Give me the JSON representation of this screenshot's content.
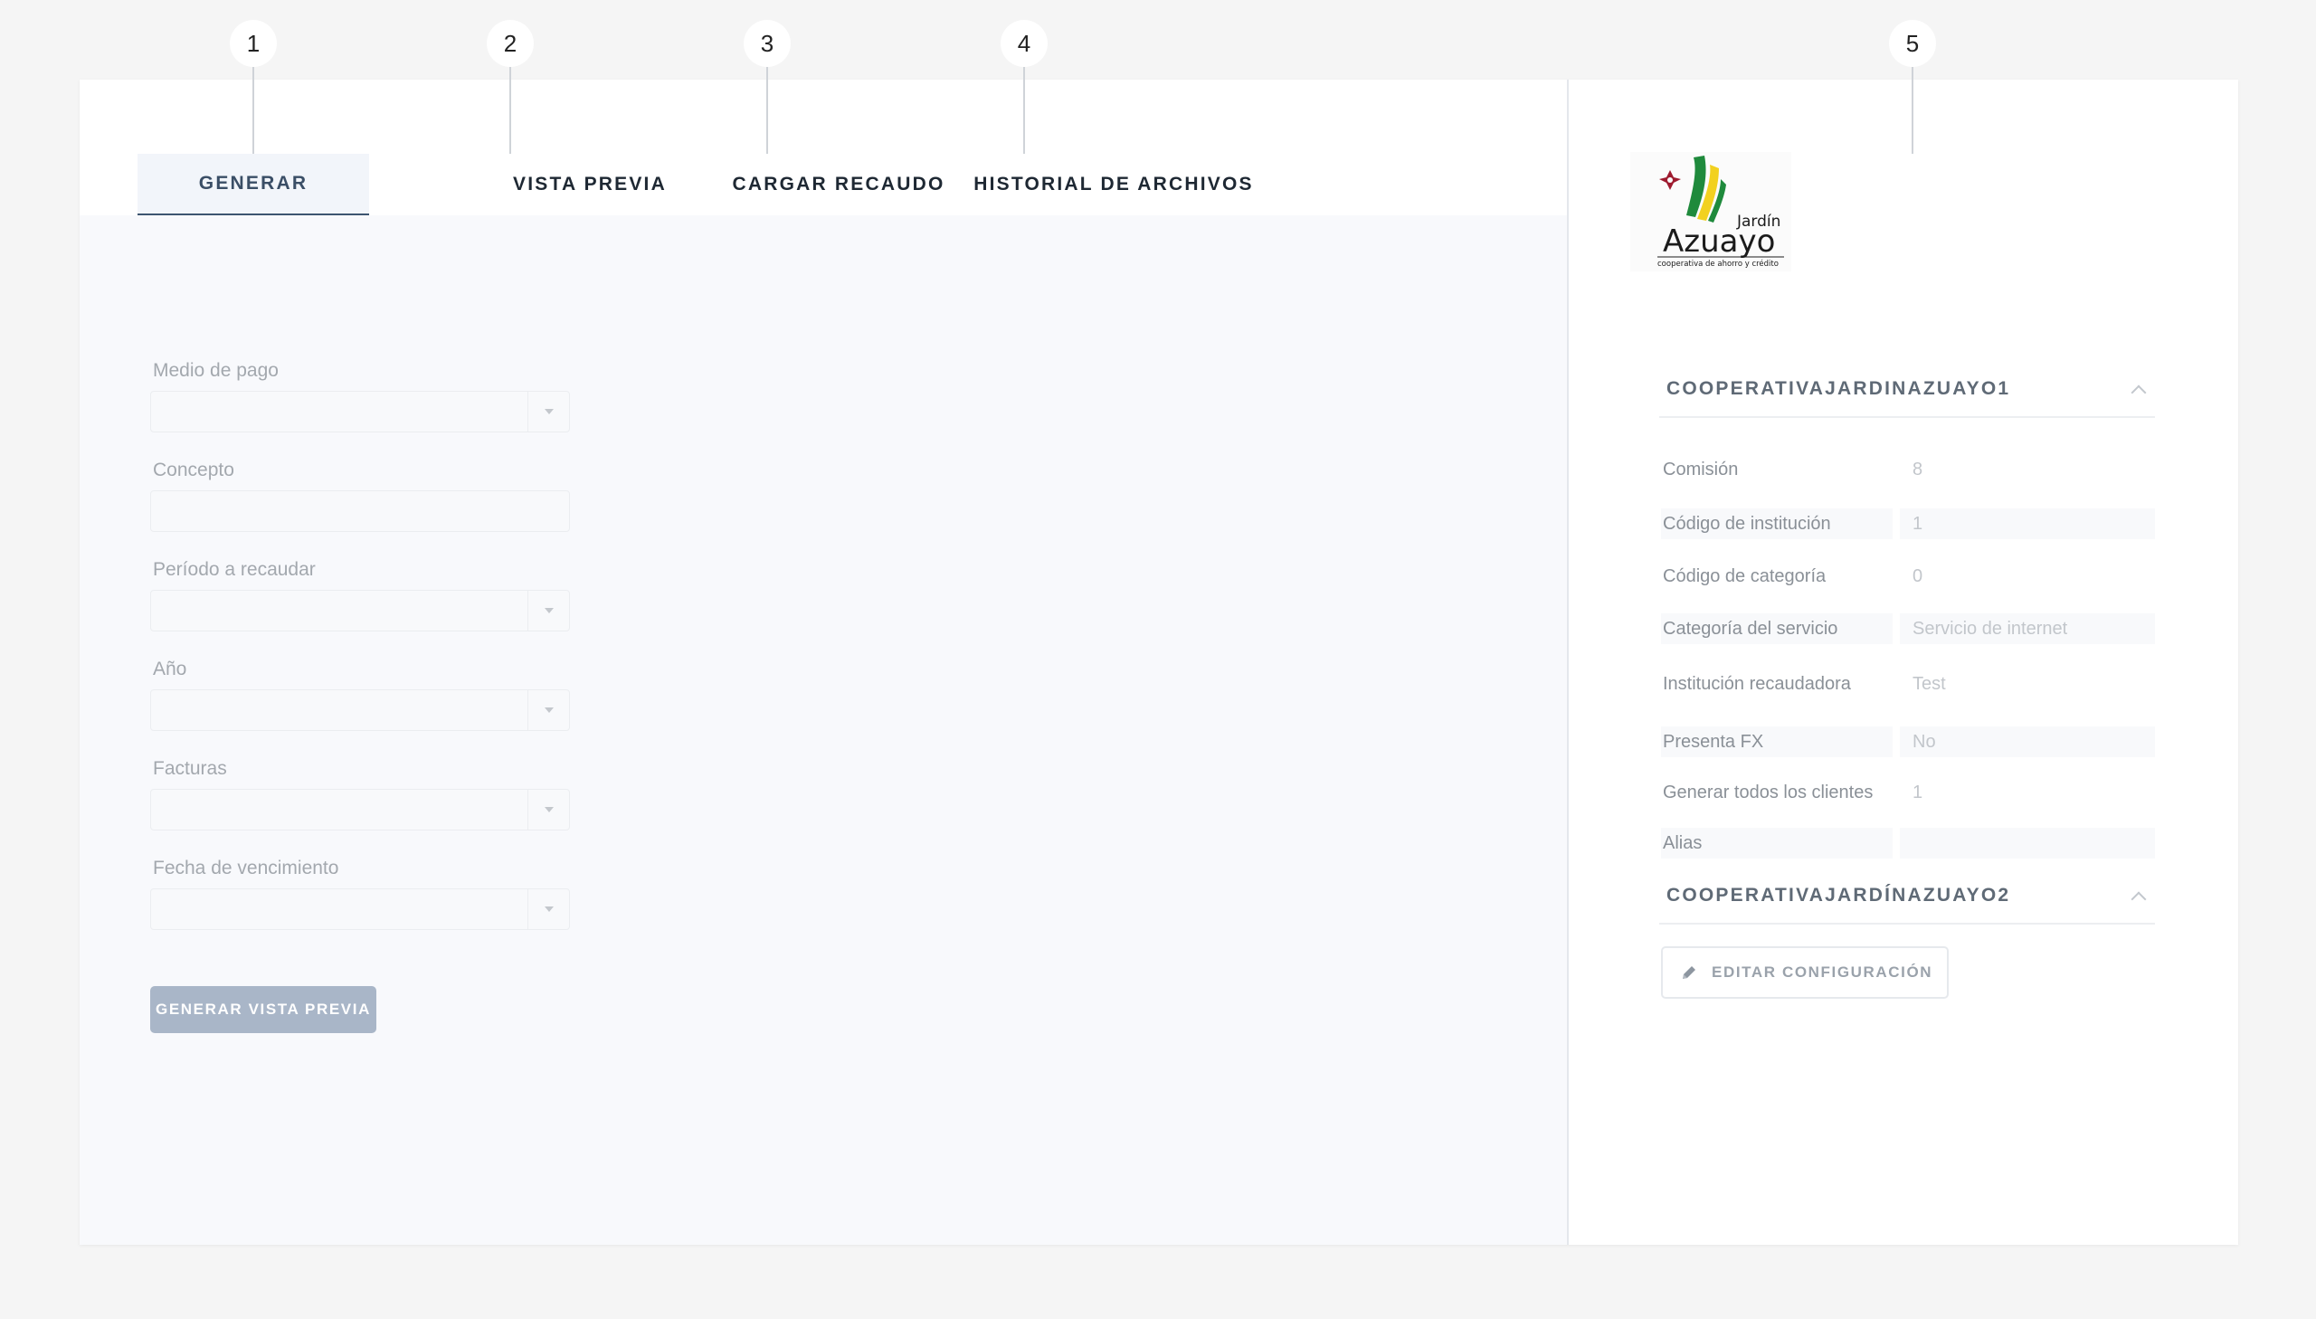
{
  "markers": [
    "1",
    "2",
    "3",
    "4",
    "5"
  ],
  "tabs": [
    {
      "label": "GENERAR",
      "active": true
    },
    {
      "label": "VISTA PREVIA",
      "active": false
    },
    {
      "label": "CARGAR RECAUDO",
      "active": false
    },
    {
      "label": "HISTORIAL DE ARCHIVOS",
      "active": false
    }
  ],
  "form": {
    "medio_pago": {
      "label": "Medio de pago",
      "value": ""
    },
    "concepto": {
      "label": "Concepto",
      "value": ""
    },
    "periodo": {
      "label": "Período a recaudar",
      "value": ""
    },
    "anio": {
      "label": "Año",
      "value": ""
    },
    "facturas": {
      "label": "Facturas",
      "value": ""
    },
    "fecha_vencimiento": {
      "label": "Fecha de vencimiento",
      "value": ""
    },
    "generate_button": "GENERAR VISTA PREVIA"
  },
  "sidebar": {
    "logo": {
      "top_text": "Jardín",
      "main_text": "Azuayo",
      "tagline": "cooperativa de ahorro y crédito",
      "colors": {
        "green": "#1f8a3c",
        "yellow": "#f2d11f",
        "dark": "#1b1b1b",
        "red": "#9e1b2f"
      }
    },
    "section1": {
      "title": "COOPERATIVAJARDINAZUAYO1",
      "fields": [
        {
          "key": "Comisión",
          "value": "8"
        },
        {
          "key": "Código de institución",
          "value": "1"
        },
        {
          "key": "Código de categoría",
          "value": "0"
        },
        {
          "key": "Categoría del servicio",
          "value": "Servicio de internet"
        },
        {
          "key": "Institución recaudadora",
          "value": "Test"
        },
        {
          "key": "Presenta FX",
          "value": "No"
        },
        {
          "key": "Generar todos los clientes",
          "value": "1"
        },
        {
          "key": "Alias",
          "value": ""
        }
      ]
    },
    "section2": {
      "title": "COOPERATIVAJARDÍNAZUAYO2"
    },
    "edit_button": "EDITAR CONFIGURACIÓN"
  },
  "colors": {
    "accent": "#3d5570",
    "button_disabled": "#a9b6c8",
    "background": "#f5f5f5"
  }
}
